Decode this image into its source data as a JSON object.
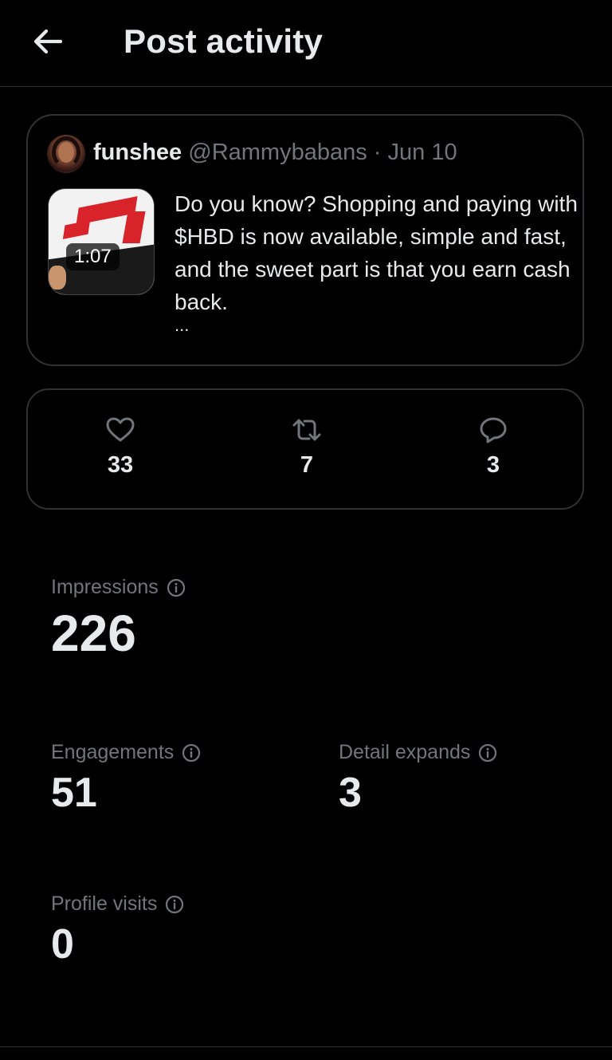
{
  "header": {
    "title": "Post activity",
    "back_icon": "arrow-left-icon"
  },
  "post": {
    "author_name": "funshee",
    "author_handle": "@Rammybabans",
    "separator": "·",
    "date": "Jun 10",
    "video_duration": "1:07",
    "text": "Do you know?  Shopping and paying with $HBD is now available, simple and fast, and the sweet part is that you earn cash back.",
    "truncation": "..."
  },
  "counts": {
    "likes": "33",
    "reposts": "7",
    "replies": "3",
    "like_icon": "heart-icon",
    "repost_icon": "repost-icon",
    "reply_icon": "reply-bubble-icon"
  },
  "metrics": {
    "impressions": {
      "label": "Impressions",
      "value": "226"
    },
    "engagements": {
      "label": "Engagements",
      "value": "51"
    },
    "detail_expands": {
      "label": "Detail expands",
      "value": "3"
    },
    "profile_visits": {
      "label": "Profile visits",
      "value": "0"
    }
  },
  "colors": {
    "background": "#000000",
    "text_primary": "#e7e9ea",
    "text_secondary": "#71767b",
    "border": "#2f3336"
  }
}
